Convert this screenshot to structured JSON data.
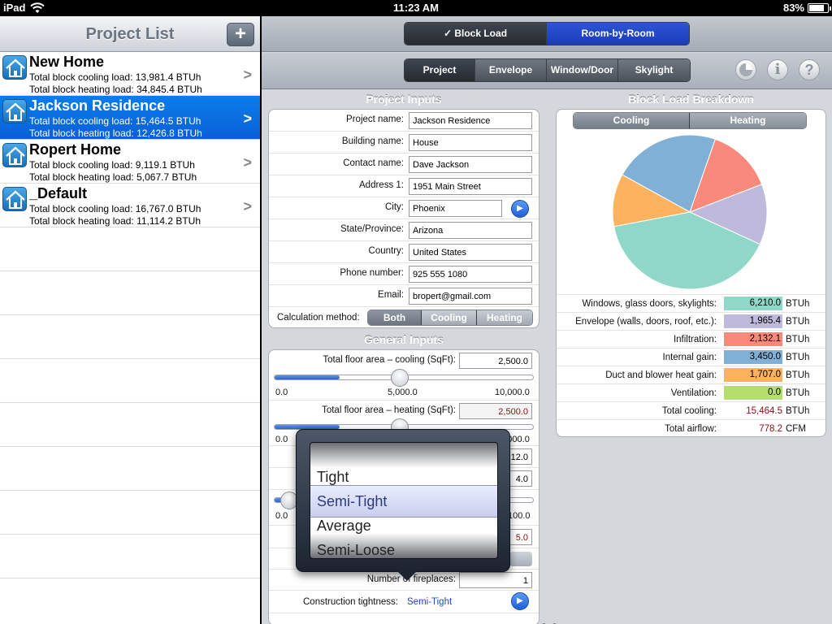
{
  "status": {
    "device": "iPad",
    "time": "11:23 AM",
    "battery": "83%",
    "battery_level": 0.83
  },
  "left": {
    "title": "Project List",
    "add_label": "+",
    "projects": [
      {
        "name": "New Home",
        "cooling": "Total block cooling load: 13,981.4 BTUh",
        "heating": "Total block heating load: 34,845.4 BTUh"
      },
      {
        "name": "Jackson Residence",
        "cooling": "Total block cooling load: 15,464.5 BTUh",
        "heating": "Total block heating load: 12,426.8 BTUh"
      },
      {
        "name": "Ropert Home",
        "cooling": "Total block cooling load: 9,119.1 BTUh",
        "heating": "Total block heating load: 5,067.7 BTUh"
      },
      {
        "name": "_Default",
        "cooling": "Total block cooling load: 16,767.0 BTUh",
        "heating": "Total block heating load: 11,114.2 BTUh"
      }
    ],
    "selected_index": 1
  },
  "mode_tabs": [
    "✓ Block Load",
    "Room-by-Room"
  ],
  "section_tabs": [
    "Project",
    "Envelope",
    "Window/Door",
    "Skylight"
  ],
  "icons": [
    "pie-chart-icon",
    "info-icon",
    "help-icon"
  ],
  "project_inputs": {
    "title": "Project Inputs",
    "fields": [
      {
        "label": "Project name:",
        "value": "Jackson Residence"
      },
      {
        "label": "Building name:",
        "value": "House"
      },
      {
        "label": "Contact name:",
        "value": "Dave Jackson"
      },
      {
        "label": "Address 1:",
        "value": "1951 Main Street"
      },
      {
        "label": "City:",
        "value": "Phoenix"
      },
      {
        "label": "State/Province:",
        "value": "Arizona"
      },
      {
        "label": "Country:",
        "value": "United States"
      },
      {
        "label": "Phone number:",
        "value": "925 555 1080"
      },
      {
        "label": "Email:",
        "value": "bropert@gmail.com"
      }
    ],
    "calc_label": "Calculation method:",
    "calc_options": [
      "Both",
      "Cooling",
      "Heating"
    ]
  },
  "breakdown": {
    "title": "Block Load Breakdown",
    "tabs": [
      "Cooling",
      "Heating"
    ],
    "rows": [
      {
        "label": "Windows, glass doors, skylights:",
        "value": "6,210.0",
        "unit": "BTUh",
        "color": "#8fd7c9"
      },
      {
        "label": "Envelope (walls, doors, roof, etc.):",
        "value": "1,965.4",
        "unit": "BTUh",
        "color": "#bfb9dc"
      },
      {
        "label": "Infiltration:",
        "value": "2,132.1",
        "unit": "BTUh",
        "color": "#f98a7b"
      },
      {
        "label": "Internal gain:",
        "value": "3,450.0",
        "unit": "BTUh",
        "color": "#80b0d5"
      },
      {
        "label": "Duct and blower heat gain:",
        "value": "1,707.0",
        "unit": "BTUh",
        "color": "#fcb25f"
      },
      {
        "label": "Ventilation:",
        "value": "0.0",
        "unit": "BTUh",
        "color": "#b5de6b"
      }
    ],
    "total_cooling": {
      "label": "Total cooling:",
      "value": "15,464.5",
      "unit": "BTUh"
    },
    "total_airflow": {
      "label": "Total airflow:",
      "value": "778.2",
      "unit": "CFM"
    }
  },
  "chart_data": {
    "type": "pie",
    "categories": [
      "Windows, glass doors, skylights",
      "Envelope (walls, doors, roof, etc.)",
      "Infiltration",
      "Internal gain",
      "Duct and blower heat gain",
      "Ventilation"
    ],
    "values": [
      6210.0,
      1965.4,
      2132.1,
      3450.0,
      1707.0,
      0.0
    ],
    "colors": [
      "#8fd7c9",
      "#bfb9dc",
      "#f98a7b",
      "#80b0d5",
      "#fcb25f",
      "#b5de6b"
    ]
  },
  "general_inputs": {
    "title": "General Inputs",
    "floor_cooling": {
      "label": "Total floor area – cooling (SqFt):",
      "value": "2,500.0",
      "min": "0.0",
      "mid": "5,000.0",
      "max": "10,000.0",
      "fraction": 0.25
    },
    "floor_heating": {
      "label": "Total floor area – heating (SqFt):",
      "value": "2,500.0",
      "min": "0.0",
      "max": "10,000.0",
      "fraction": 0.25
    },
    "partial_values": [
      "12.0",
      "4.0",
      "0.0",
      "100.0",
      "5.0"
    ],
    "fireplaces": {
      "label": "Number of fireplaces:",
      "value": "1"
    },
    "tightness": {
      "label": "Construction tightness:",
      "value": "Semi-Tight"
    }
  },
  "picker": {
    "options": [
      "Tight",
      "Semi-Tight",
      "Average",
      "Semi-Loose"
    ],
    "selected": "Semi-Tight"
  },
  "page_dots": 3
}
